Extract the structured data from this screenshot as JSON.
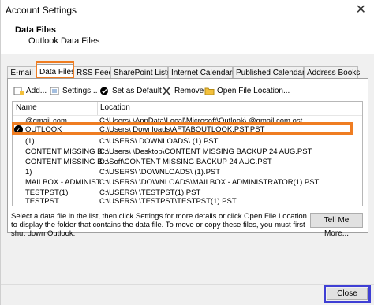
{
  "window": {
    "title": "Account Settings",
    "close_glyph": "✕"
  },
  "header": {
    "title": "Data Files",
    "subtitle": "Outlook Data Files"
  },
  "tabs": [
    {
      "label": "E-mail"
    },
    {
      "label": "Data Files"
    },
    {
      "label": "RSS Feeds"
    },
    {
      "label": "SharePoint Lists"
    },
    {
      "label": "Internet Calendars"
    },
    {
      "label": "Published Calendars"
    },
    {
      "label": "Address Books"
    }
  ],
  "toolbar": {
    "add_label": "Add...",
    "settings_label": "Settings...",
    "default_label": "Set as Default",
    "remove_label": "Remove",
    "open_location_label": "Open File Location..."
  },
  "table": {
    "headers": {
      "name": "Name",
      "location": "Location"
    },
    "rows": [
      {
        "name": "@gmail.com",
        "location": "C:\\Users\\  \\AppData\\Local\\Microsoft\\Outlook\\  @gmail.com.ost",
        "selected": false
      },
      {
        "name": "OUTLOOK",
        "location": "C:\\Users\\  Downloads\\AFTABOUTLOOK.PST.PST",
        "selected": true
      },
      {
        "name": "(1)",
        "location": "C:\\USERS\\  DOWNLOADS\\  (1).PST",
        "selected": false
      },
      {
        "name": "CONTENT MISSING B...",
        "location": "C:\\Users\\  \\Desktop\\CONTENT MISSING BACKUP 24 AUG.PST",
        "selected": false
      },
      {
        "name": "CONTENT MISSING B...",
        "location": "D:\\Soft\\CONTENT MISSING BACKUP 24 AUG.PST",
        "selected": false
      },
      {
        "name": "1)",
        "location": "C:\\USERS\\  \\DOWNLOADS\\  (1).PST",
        "selected": false
      },
      {
        "name": "MAILBOX - ADMINIST...",
        "location": "C:\\USERS\\  \\DOWNLOADS\\MAILBOX - ADMINISTRATOR(1).PST",
        "selected": false
      },
      {
        "name": "TESTPST(1)",
        "location": "C:\\USERS\\  \\TESTPST(1).PST",
        "selected": false
      },
      {
        "name": "TESTPST",
        "location": "C:\\USERS\\  \\TESTPST\\TESTPST(1).PST",
        "selected": false
      }
    ]
  },
  "help_text": "Select a data file in the list, then click Settings for more details or click Open File Location to display the folder that contains the data file. To move or copy these files, you must first shut down Outlook.",
  "tell_me_more": "Tell Me More...",
  "close_button": "Close",
  "colors": {
    "highlight_orange": "#ef7d22",
    "highlight_blue": "#3f3fd4"
  }
}
